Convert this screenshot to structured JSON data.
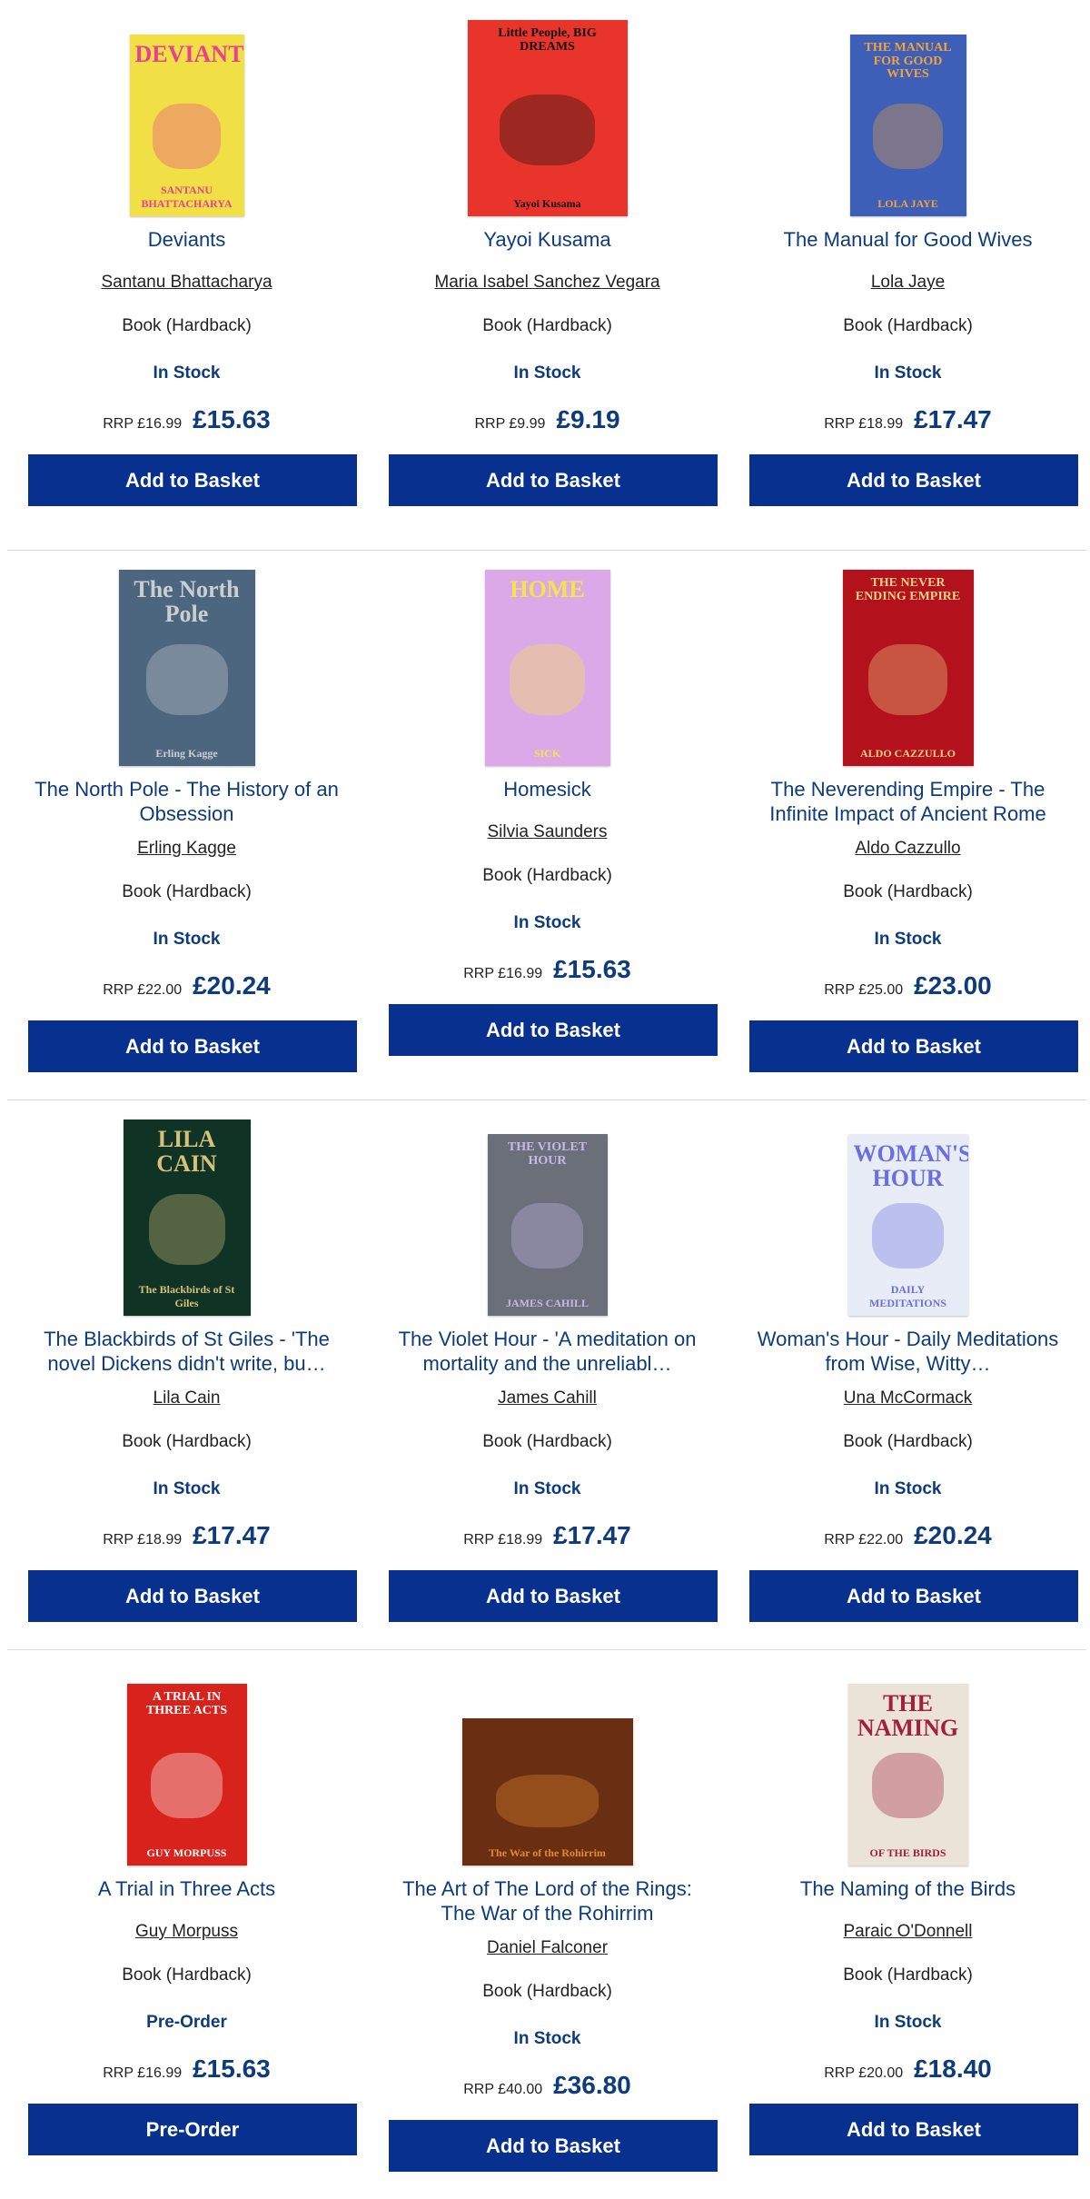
{
  "rows": [
    [
      {
        "title": "Deviants",
        "author": "Santanu Bhattacharya",
        "format": "Book (Hardback)",
        "stock": "In Stock",
        "rrp": "RRP £16.99",
        "price": "£15.63",
        "button": "Add to Basket",
        "cover": {
          "top_text": "DEVIANTS",
          "bottom_text": "SANTANU BHATTACHARYA",
          "bg": "#f0e046",
          "accent": "#e8418e"
        }
      },
      {
        "title": "Yayoi Kusama",
        "author": "Maria Isabel Sanchez Vegara",
        "format": "Book (Hardback)",
        "stock": "In Stock",
        "rrp": "RRP £9.99",
        "price": "£9.19",
        "button": "Add to Basket",
        "cover": {
          "top_text": "Little People, BIG DREAMS",
          "bottom_text": "Yayoi Kusama",
          "bg": "#e8342a",
          "accent": "#111111"
        }
      },
      {
        "title": "The Manual for Good Wives",
        "author": "Lola Jaye",
        "format": "Book (Hardback)",
        "stock": "In Stock",
        "rrp": "RRP £18.99",
        "price": "£17.47",
        "button": "Add to Basket",
        "cover": {
          "top_text": "THE MANUAL FOR GOOD WIVES",
          "bottom_text": "LOLA JAYE",
          "bg": "#3e5fb8",
          "accent": "#f2a33a"
        }
      }
    ],
    [
      {
        "title": "The North Pole - The History of an Obsession",
        "author": "Erling Kagge",
        "format": "Book (Hardback)",
        "stock": "In Stock",
        "rrp": "RRP £22.00",
        "price": "£20.24",
        "button": "Add to Basket",
        "cover": {
          "top_text": "The North Pole",
          "bottom_text": "Erling Kagge",
          "bg": "#4d6680",
          "accent": "#c9cfcf"
        }
      },
      {
        "title": "Homesick",
        "author": "Silvia Saunders",
        "format": "Book (Hardback)",
        "stock": "In Stock",
        "rrp": "RRP £16.99",
        "price": "£15.63",
        "button": "Add to Basket",
        "cover": {
          "top_text": "HOME",
          "bottom_text": "SICK",
          "bg": "#dca9e8",
          "accent": "#f6e34a"
        }
      },
      {
        "title": "The Neverending Empire - The Infinite Impact of Ancient Rome",
        "author": "Aldo Cazzullo",
        "format": "Book (Hardback)",
        "stock": "In Stock",
        "rrp": "RRP £25.00",
        "price": "£23.00",
        "button": "Add to Basket",
        "cover": {
          "top_text": "THE NEVER ENDING EMPIRE",
          "bottom_text": "ALDO CAZZULLO",
          "bg": "#b3121c",
          "accent": "#f1d38a"
        }
      }
    ],
    [
      {
        "title": "The Blackbirds of St Giles - 'The novel Dickens didn't write, bu…",
        "author": "Lila Cain",
        "format": "Book (Hardback)",
        "stock": "In Stock",
        "rrp": "RRP £18.99",
        "price": "£17.47",
        "button": "Add to Basket",
        "cover": {
          "top_text": "LILA CAIN",
          "bottom_text": "The Blackbirds of St Giles",
          "bg": "#0f3325",
          "accent": "#d8c07a"
        }
      },
      {
        "title": "The Violet Hour - 'A meditation on mortality and the unreliabl…",
        "author": "James Cahill",
        "format": "Book (Hardback)",
        "stock": "In Stock",
        "rrp": "RRP £18.99",
        "price": "£17.47",
        "button": "Add to Basket",
        "cover": {
          "top_text": "THE VIOLET HOUR",
          "bottom_text": "JAMES CAHILL",
          "bg": "#6b6f7a",
          "accent": "#c6b8e8"
        }
      },
      {
        "title": "Woman's Hour - Daily Meditations from Wise, Witty…",
        "author": "Una McCormack",
        "format": "Book (Hardback)",
        "stock": "In Stock",
        "rrp": "RRP £22.00",
        "price": "£20.24",
        "button": "Add to Basket",
        "cover": {
          "top_text": "WOMAN'S HOUR",
          "bottom_text": "DAILY MEDITATIONS",
          "bg": "#e8ecf6",
          "accent": "#6a6fe0"
        }
      }
    ],
    [
      {
        "title": "A Trial in Three Acts",
        "author": "Guy Morpuss",
        "format": "Book (Hardback)",
        "stock": "Pre-Order",
        "rrp": "RRP £16.99",
        "price": "£15.63",
        "button": "Pre-Order",
        "cover": {
          "top_text": "A TRIAL IN THREE ACTS",
          "bottom_text": "GUY MORPUSS",
          "bg": "#d8231c",
          "accent": "#ffffff"
        }
      },
      {
        "title": "The Art of The Lord of the Rings: The War of the Rohirrim",
        "author": "Daniel Falconer",
        "format": "Book (Hardback)",
        "stock": "In Stock",
        "rrp": "RRP £40.00",
        "price": "£36.80",
        "button": "Add to Basket",
        "cover": {
          "top_text": "",
          "bottom_text": "The War of the Rohirrim",
          "bg": "#6a2f12",
          "accent": "#e08a2e"
        }
      },
      {
        "title": "The Naming of the Birds",
        "author": "Paraic O'Donnell",
        "format": "Book (Hardback)",
        "stock": "In Stock",
        "rrp": "RRP £20.00",
        "price": "£18.40",
        "button": "Add to Basket",
        "cover": {
          "top_text": "THE NAMING",
          "bottom_text": "OF THE BIRDS",
          "bg": "#eae3d6",
          "accent": "#a3203a"
        }
      }
    ]
  ]
}
